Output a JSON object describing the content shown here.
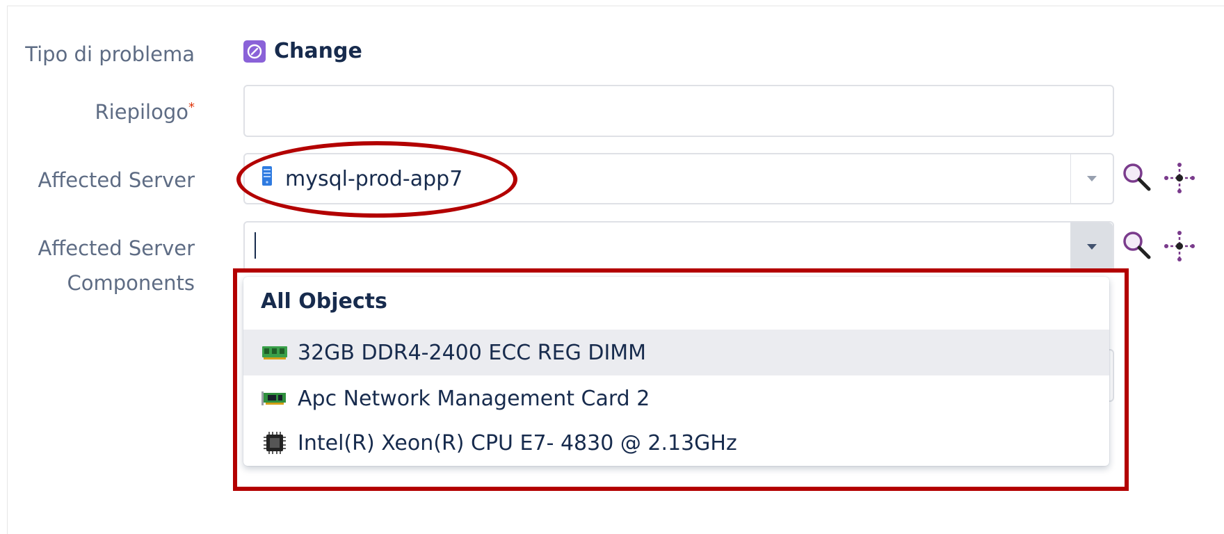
{
  "form": {
    "issue_type": {
      "label": "Tipo di problema",
      "value": "Change",
      "accent_color": "#8a62d8"
    },
    "summary": {
      "label": "Riepilogo",
      "required_mark": "*",
      "value": "",
      "placeholder": ""
    },
    "affected_server": {
      "label": "Affected Server",
      "value": "mysql-prod-app7",
      "value_icon": "server-icon"
    },
    "affected_components": {
      "label_line1": "Affected Server",
      "label_line2": "Components",
      "value": ""
    }
  },
  "dropdown": {
    "header": "All Objects",
    "items": [
      {
        "label": "32GB DDR4-2400 ECC REG DIMM",
        "icon": "memory-icon"
      },
      {
        "label": "Apc Network Management Card 2",
        "icon": "network-card-icon"
      },
      {
        "label": "Intel(R) Xeon(R) CPU E7- 4830 @ 2.13GHz",
        "icon": "cpu-icon"
      }
    ]
  },
  "colors": {
    "annotation": "#b30000",
    "label": "#5e6c84",
    "text": "#172b4d",
    "tool_icon": "#7a3b8c"
  }
}
